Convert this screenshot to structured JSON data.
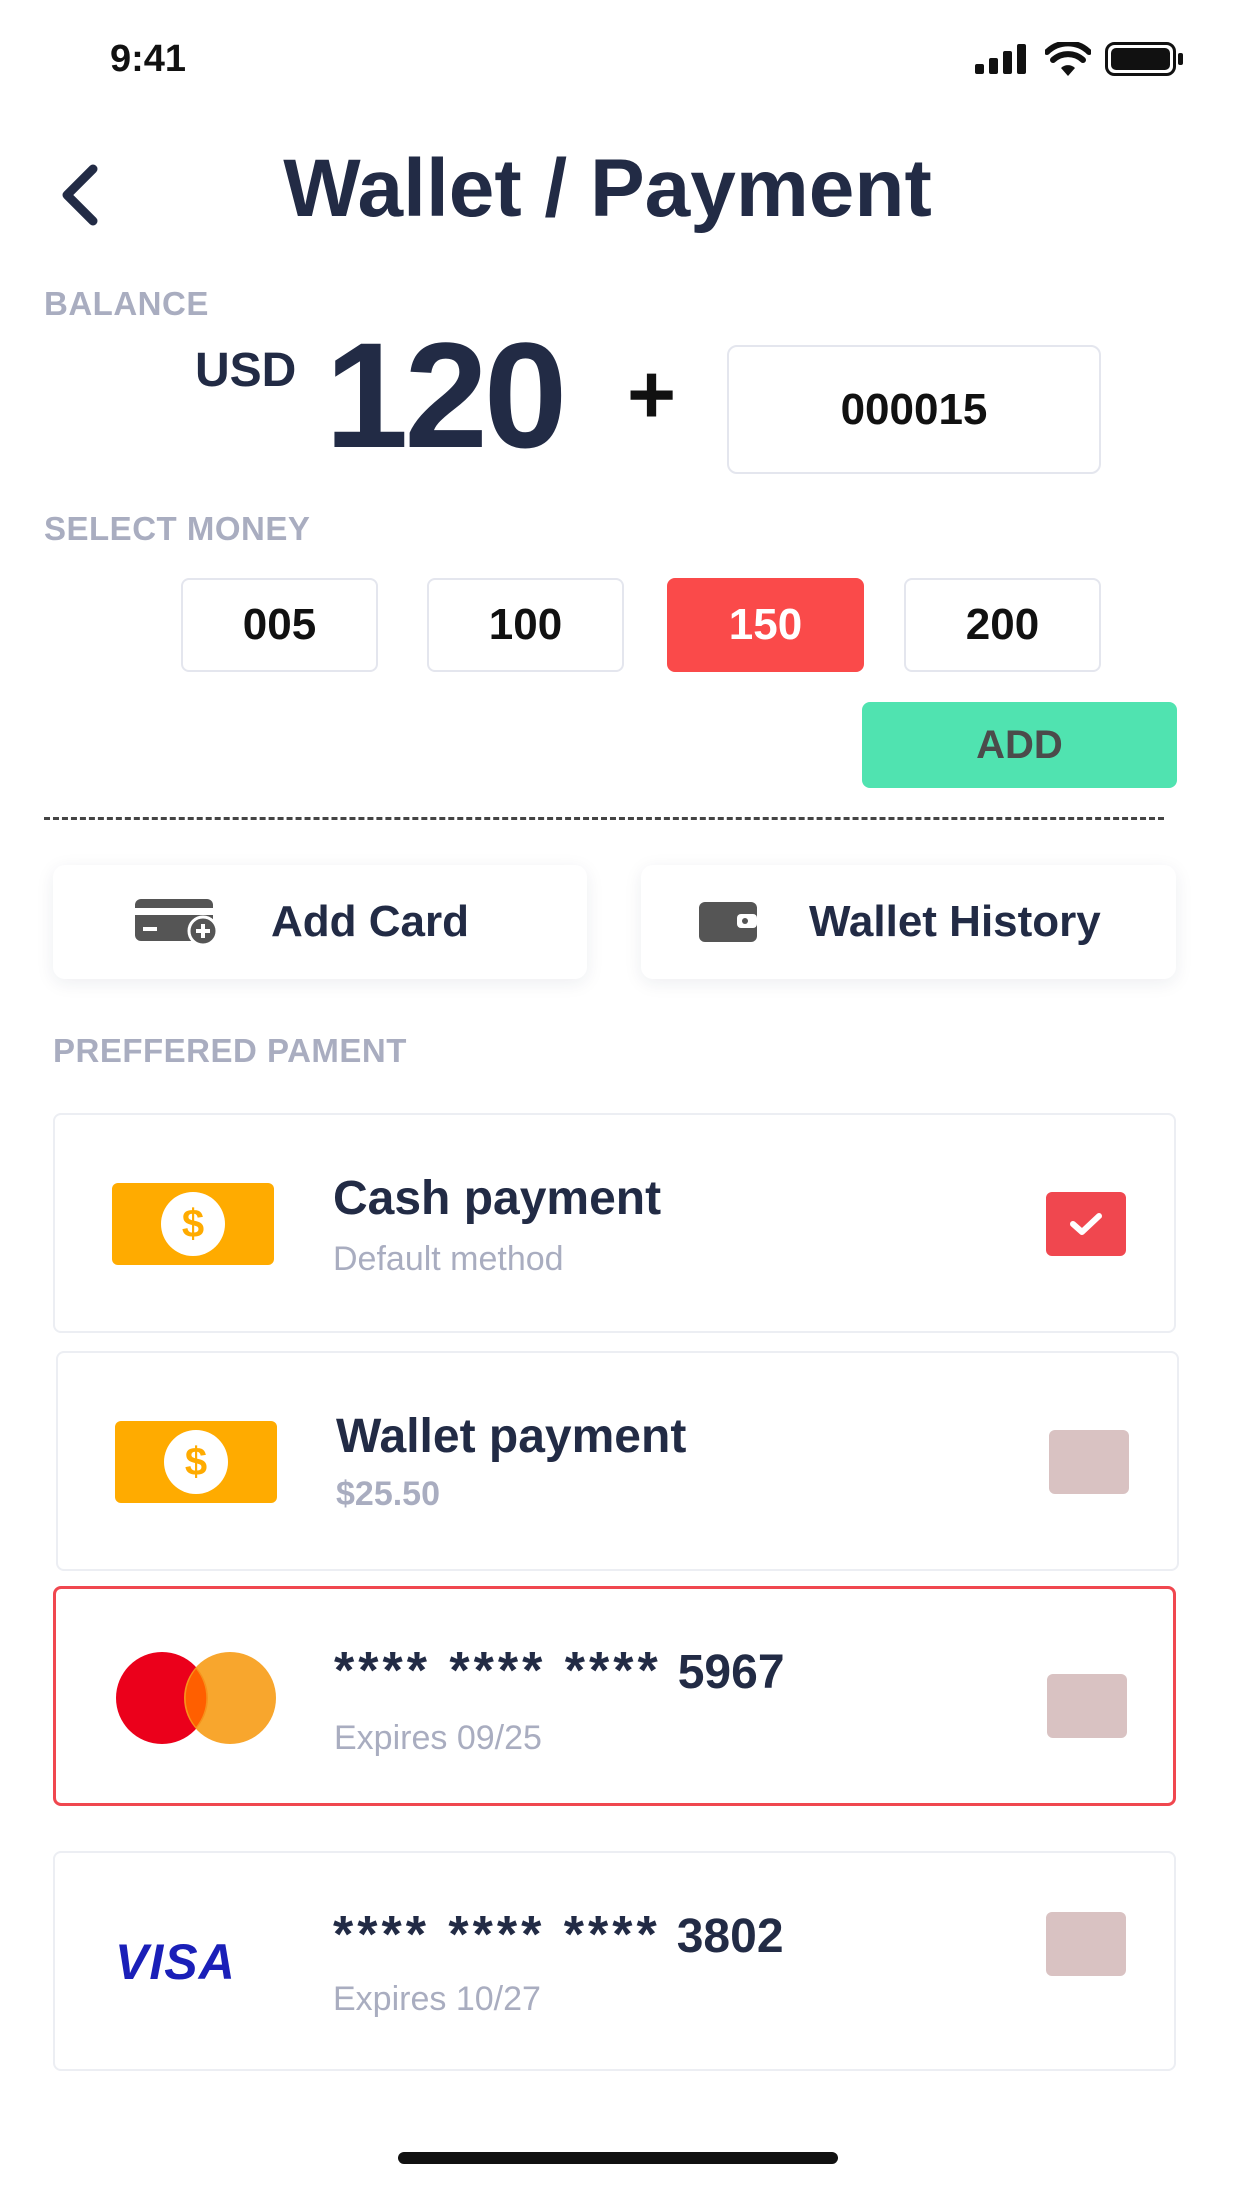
{
  "status_bar": {
    "time": "9:41"
  },
  "header": {
    "title": "Wallet / Payment"
  },
  "balance": {
    "label": "BALANCE",
    "currency": "USD",
    "amount": "120",
    "plus": "+",
    "input_value": "000015"
  },
  "select_money": {
    "label": "SELECT MONEY",
    "options": [
      "005",
      "100",
      "150",
      "200"
    ],
    "selected": "150",
    "add_label": "ADD"
  },
  "actions": {
    "add_card": "Add Card",
    "wallet_history": "Wallet History"
  },
  "preferred": {
    "label": "PREFFERED PAMENT",
    "methods": [
      {
        "title": "Cash payment",
        "subtitle": "Default method",
        "checked": true
      },
      {
        "title": "Wallet payment",
        "subtitle": "$25.50",
        "checked": false
      },
      {
        "stars": "**** **** ****",
        "last4": "5967",
        "subtitle": "Expires 09/25",
        "brand": "mastercard-logo",
        "checked": false
      },
      {
        "stars": "**** **** ****",
        "last4": "3802",
        "subtitle": "Expires 10/27",
        "brand": "VISA",
        "checked": false
      }
    ]
  },
  "colors": {
    "accent_red": "#fa4a4a",
    "add_green": "#50e3b0",
    "coin_orange": "#ffab00",
    "navy": "#222b45"
  }
}
